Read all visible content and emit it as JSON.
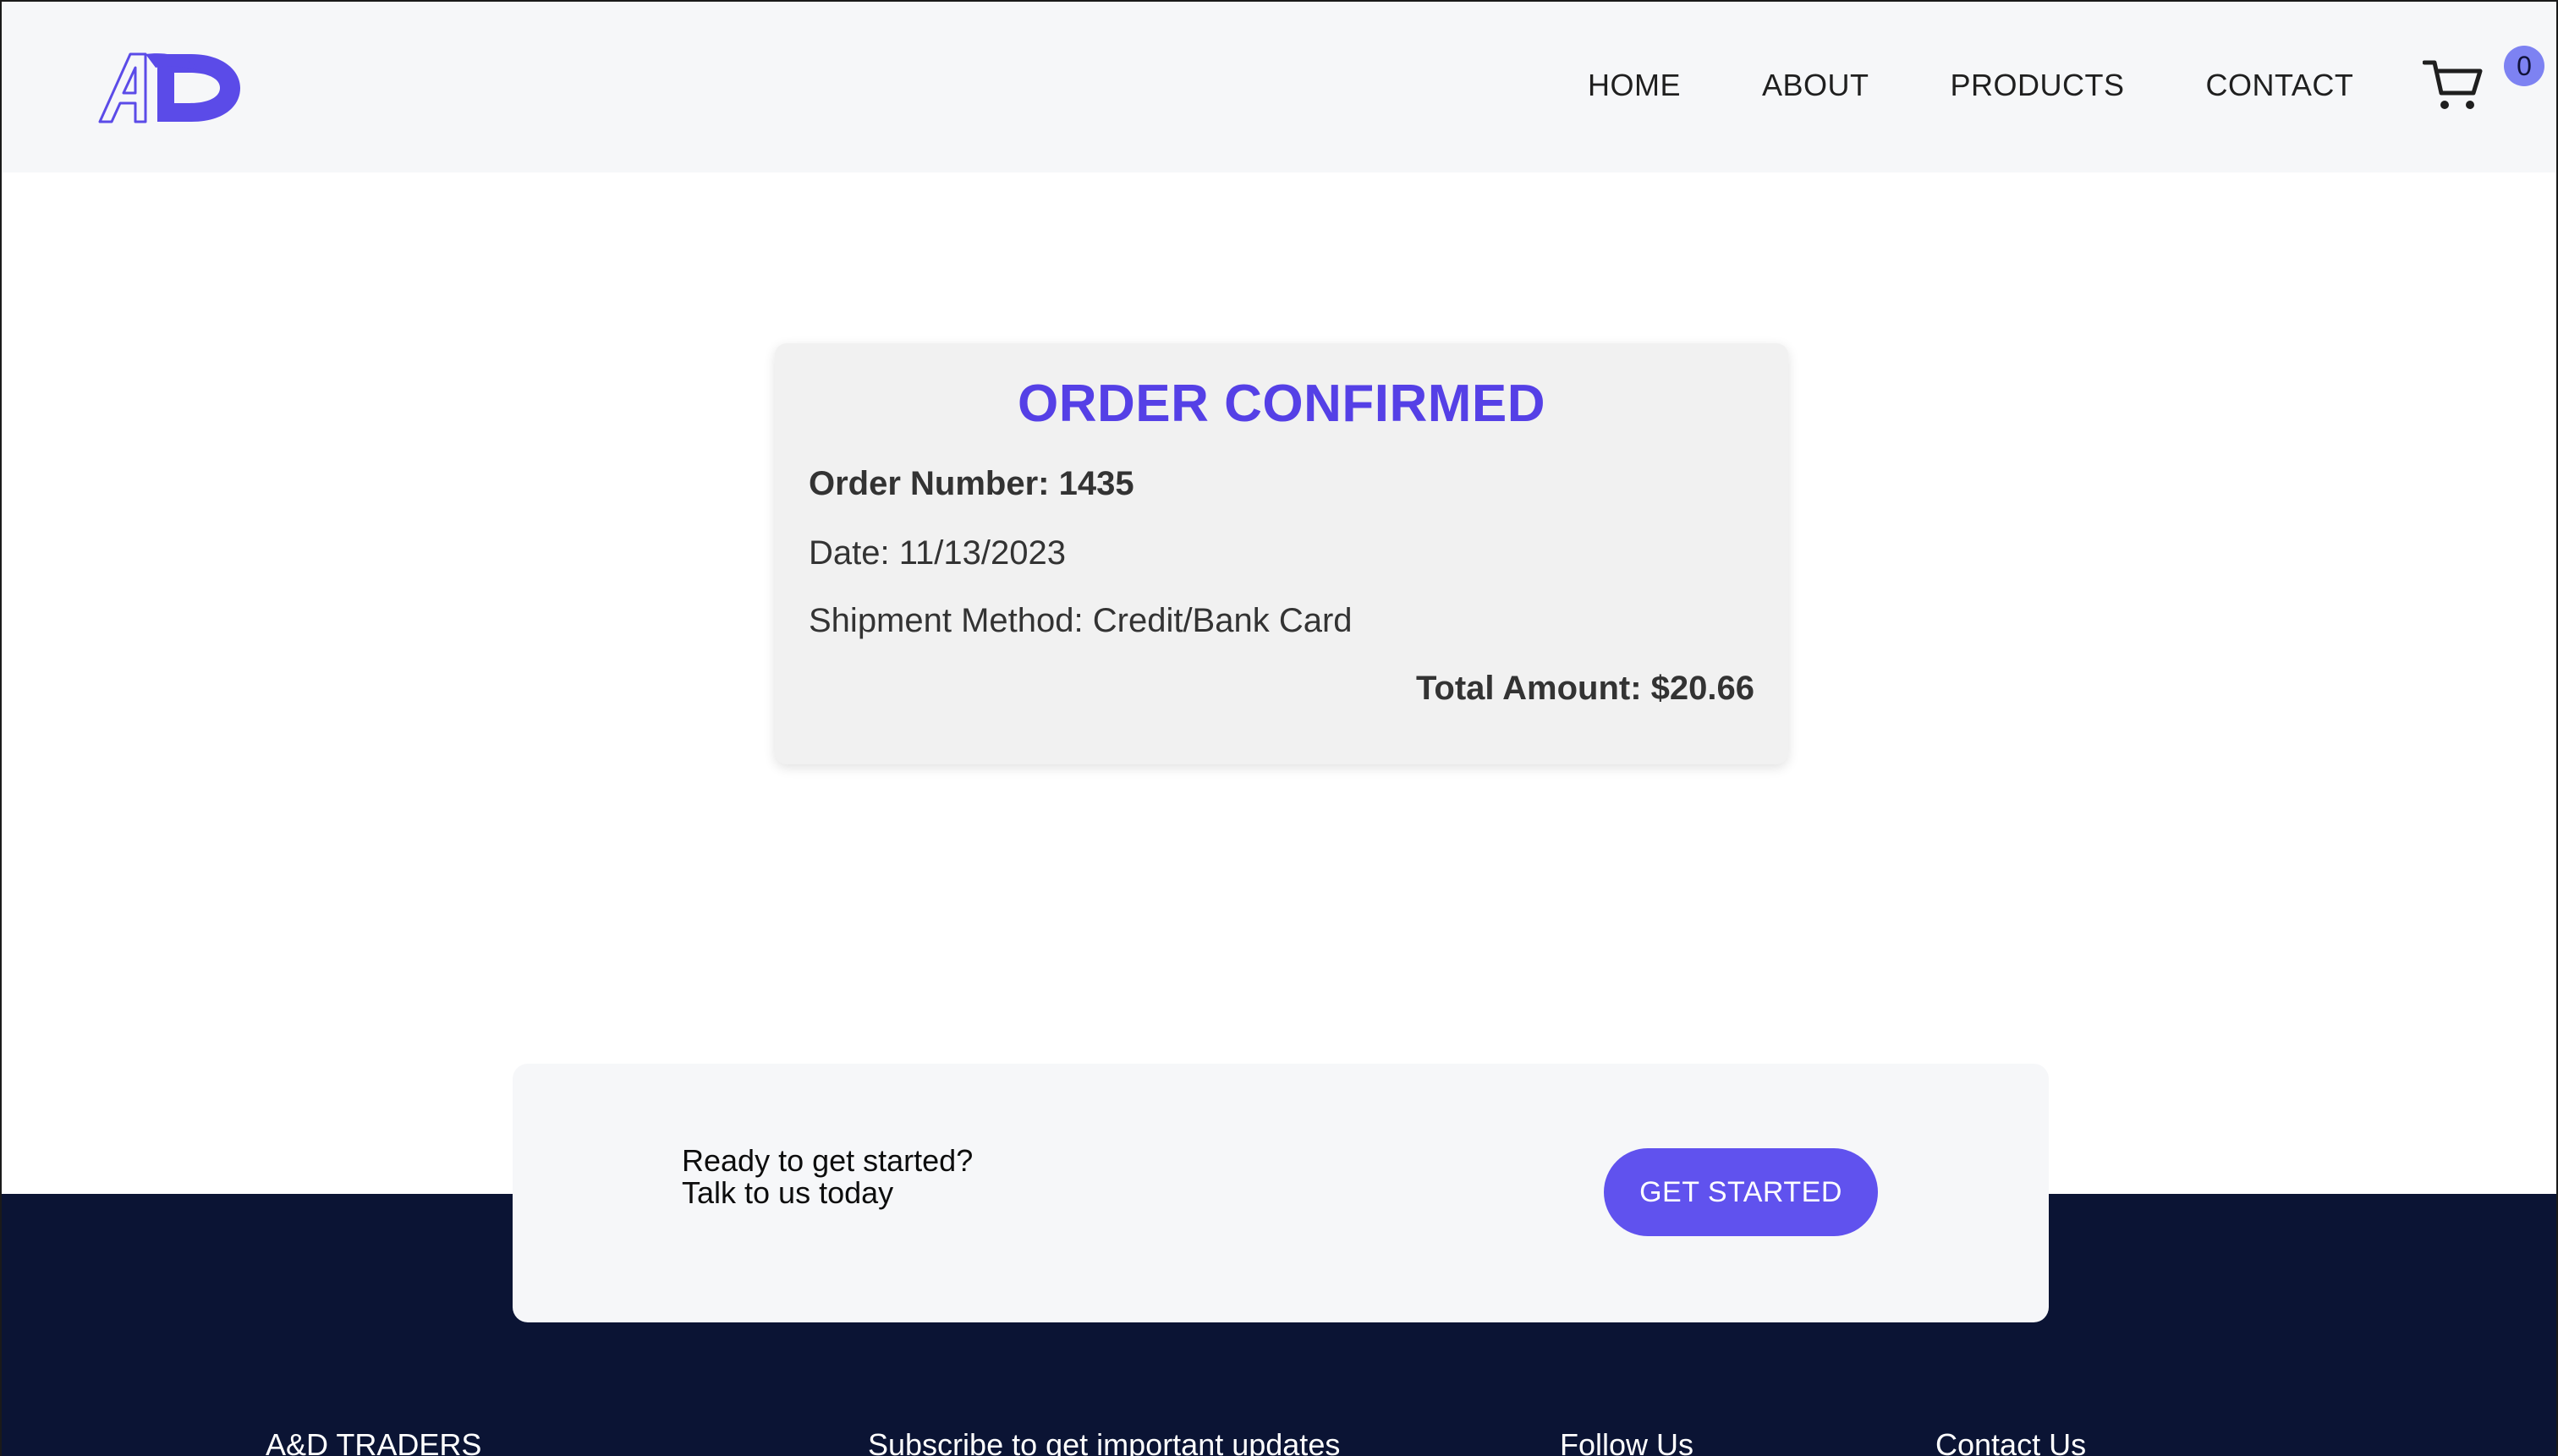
{
  "brand": {
    "logo_text": "AD",
    "accent_color": "#5b4be8"
  },
  "nav": {
    "items": [
      {
        "label": "HOME"
      },
      {
        "label": "ABOUT"
      },
      {
        "label": "PRODUCTS"
      },
      {
        "label": "CONTACT"
      }
    ],
    "cart_icon": "cart-icon",
    "cart_count": "0"
  },
  "order": {
    "title": "ORDER CONFIRMED",
    "number": "Order Number: 1435",
    "date": "Date: 11/13/2023",
    "shipment": "Shipment Method: Credit/Bank Card",
    "total": "Total Amount: $20.66"
  },
  "cta": {
    "line1": "Ready to get started?",
    "line2": "Talk to us today",
    "button": "GET STARTED"
  },
  "footer": {
    "columns": [
      {
        "title": "A&D TRADERS"
      },
      {
        "title": "Subscribe to get important updates"
      },
      {
        "title": "Follow Us"
      },
      {
        "title": "Contact Us"
      }
    ],
    "background": "#0b1434"
  }
}
